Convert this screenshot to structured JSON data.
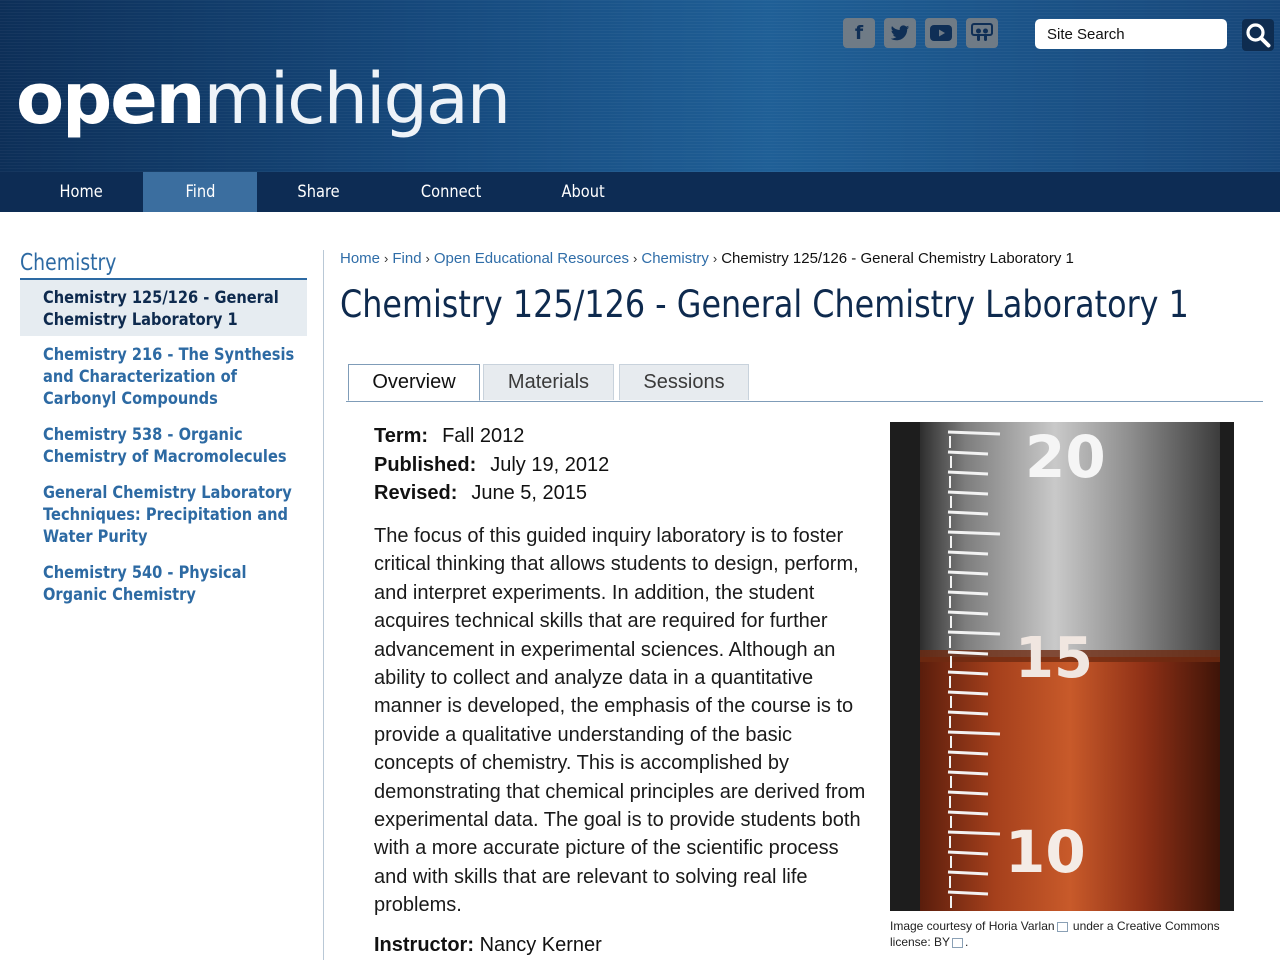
{
  "header": {
    "logo_open": "open",
    "logo_michigan": "michigan",
    "search_placeholder": "Site Search",
    "social_icons": [
      "facebook-icon",
      "twitter-icon",
      "youtube-icon",
      "slideshare-icon"
    ]
  },
  "nav": {
    "items": [
      {
        "label": "Home",
        "active": false
      },
      {
        "label": "Find",
        "active": true
      },
      {
        "label": "Share",
        "active": false
      },
      {
        "label": "Connect",
        "active": false
      },
      {
        "label": "About",
        "active": false
      }
    ]
  },
  "sidebar": {
    "heading": "Chemistry",
    "items": [
      {
        "label": "Chemistry 125/126 - General Chemistry Laboratory 1",
        "current": true
      },
      {
        "label": "Chemistry 216 - The Synthesis and Characterization of Carbonyl Compounds",
        "current": false
      },
      {
        "label": "Chemistry 538 - Organic Chemistry of Macromolecules",
        "current": false
      },
      {
        "label": "General Chemistry Laboratory Techniques: Precipitation and Water Purity",
        "current": false
      },
      {
        "label": "Chemistry 540 - Physical Organic Chemistry",
        "current": false
      }
    ]
  },
  "breadcrumb": {
    "links": [
      "Home",
      "Find",
      "Open Educational Resources",
      "Chemistry"
    ],
    "current": "Chemistry 125/126 - General Chemistry Laboratory 1"
  },
  "main": {
    "title": "Chemistry 125/126 - General Chemistry Laboratory 1",
    "tabs": [
      {
        "label": "Overview",
        "active": true
      },
      {
        "label": "Materials",
        "active": false
      },
      {
        "label": "Sessions",
        "active": false
      }
    ],
    "meta": {
      "term_label": "Term:",
      "term_value": "Fall 2012",
      "published_label": "Published:",
      "published_value": "July 19, 2012",
      "revised_label": "Revised:",
      "revised_value": "June 5, 2015"
    },
    "description": "The focus of this guided inquiry laboratory is to foster critical thinking that allows students to design, perform, and interpret experiments. In addition, the student acquires technical skills that are required for further advancement in experimental sciences. Although an ability to collect and analyze data in a quantitative manner is developed, the emphasis of the course is to provide a qualitative understanding of the basic concepts of chemistry. This is accomplished by demonstrating that chemical principles are derived from experimental data. The goal is to provide students both with a more accurate picture of the scientific process and with skills that are relevant to solving real life problems.",
    "instructor_label": "Instructor:",
    "instructor_value": "Nancy Kerner"
  },
  "image": {
    "scale_labels": [
      "20",
      "15",
      "10"
    ],
    "caption_prefix": "Image courtesy of",
    "caption_author": "Horia Varlan",
    "caption_middle": "under a Creative Commons license:",
    "caption_license": "BY",
    "caption_end": "."
  },
  "colors": {
    "header_blue": "#164a7e",
    "nav_blue": "#0d2c54",
    "nav_active": "#3b6e9f",
    "link_blue": "#2f6da8",
    "title_navy": "#0e2a4e",
    "liquid": "#b4451f"
  }
}
